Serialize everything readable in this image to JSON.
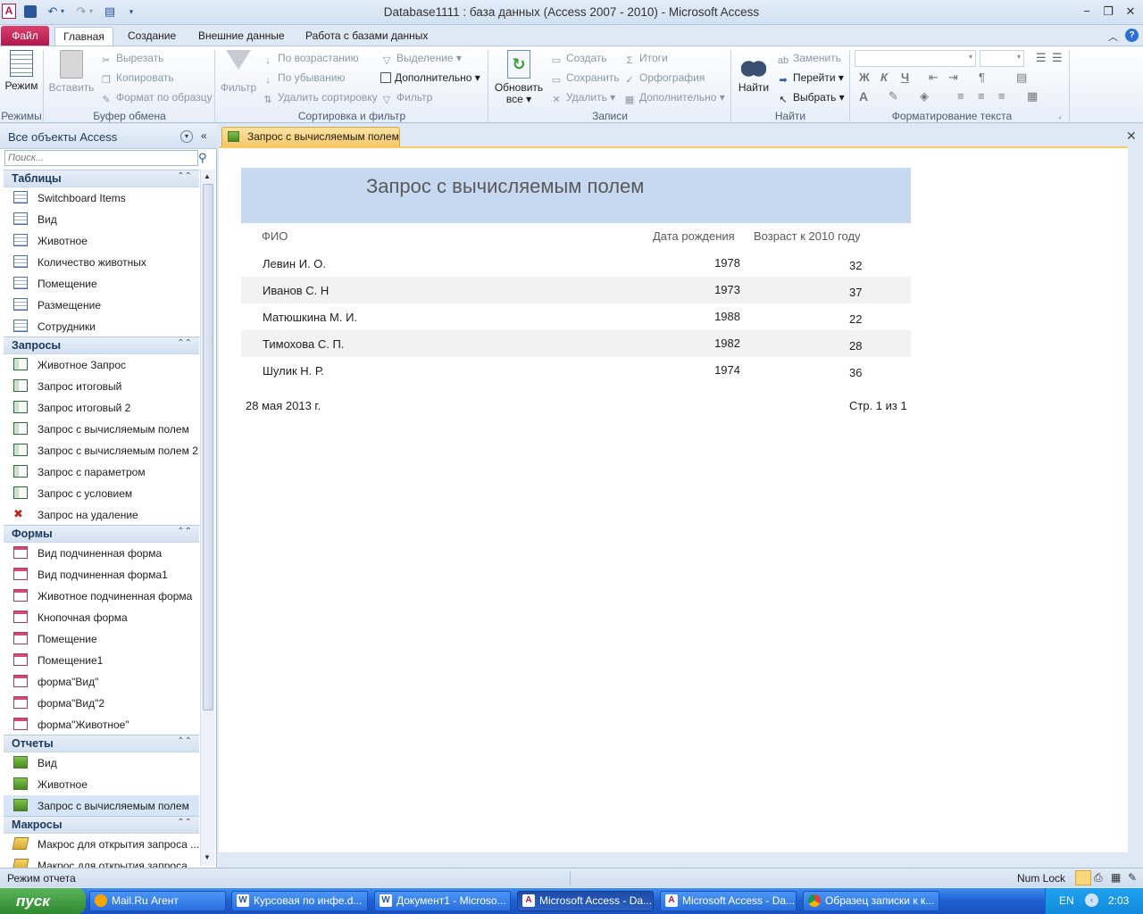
{
  "window": {
    "title": "Database1111 : база данных (Access 2007 - 2010)  -  Microsoft Access"
  },
  "ribbon": {
    "tabs": [
      "Файл",
      "Главная",
      "Создание",
      "Внешние данные",
      "Работа с базами данных"
    ],
    "groups": {
      "views": {
        "label": "Режимы",
        "button": "Режим"
      },
      "clipboard": {
        "label": "Буфер обмена",
        "paste": "Вставить",
        "cut": "Вырезать",
        "copy": "Копировать",
        "format_painter": "Формат по образцу"
      },
      "sort_filter": {
        "label": "Сортировка и фильтр",
        "filter": "Фильтр",
        "ascending": "По возрастанию",
        "descending": "По убыванию",
        "remove_sort": "Удалить сортировку",
        "selection": "Выделение",
        "advanced": "Дополнительно",
        "toggle_filter": "Фильтр"
      },
      "records": {
        "label": "Записи",
        "refresh_line1": "Обновить",
        "refresh_line2": "все",
        "new": "Создать",
        "save": "Сохранить",
        "delete": "Удалить",
        "totals": "Итоги",
        "spelling": "Орфография",
        "more": "Дополнительно"
      },
      "find": {
        "label": "Найти",
        "find": "Найти",
        "replace": "Заменить",
        "goto": "Перейти",
        "select": "Выбрать"
      },
      "text_format": {
        "label": "Форматирование текста",
        "bold": "Ж",
        "italic": "К",
        "underline": "Ч"
      }
    }
  },
  "nav": {
    "header": "Все объекты Access",
    "search_placeholder": "Поиск...",
    "sections": [
      {
        "title": "Таблицы",
        "type": "table",
        "items": [
          "Switchboard Items",
          "Вид",
          "Животное",
          "Количество животных",
          "Помещение",
          "Размещение",
          "Сотрудники"
        ]
      },
      {
        "title": "Запросы",
        "type": "query",
        "items": [
          "Животное Запрос",
          "Запрос итоговый",
          "Запрос итоговый 2",
          "Запрос с вычисляемым полем",
          "Запрос с вычисляемым полем 2",
          "Запрос с параметром",
          "Запрос с условием",
          "Запрос на удаление"
        ]
      },
      {
        "title": "Формы",
        "type": "form",
        "items": [
          "Вид подчиненная форма",
          "Вид подчиненная форма1",
          "Животное подчиненная форма",
          "Кнопочная форма",
          "Помещение",
          "Помещение1",
          "форма\"Вид\"",
          "форма\"Вид\"2",
          "форма\"Животное\""
        ]
      },
      {
        "title": "Отчеты",
        "type": "report",
        "items": [
          "Вид",
          "Животное",
          "Запрос с вычисляемым полем"
        ]
      },
      {
        "title": "Макросы",
        "type": "macro",
        "items": [
          "Макрос для открытия запроса ...",
          "Макрос для открытия запроса ..."
        ]
      }
    ]
  },
  "document": {
    "tab_title": "Запрос с вычисляемым полем",
    "report": {
      "title": "Запрос с вычисляемым полем",
      "columns": [
        "ФИО",
        "Дата рождения",
        "Возраст к 2010 году"
      ],
      "rows": [
        {
          "fio": "Левин И. О.",
          "year": "1978",
          "age": "32"
        },
        {
          "fio": "Иванов С. Н",
          "year": "1973",
          "age": "37"
        },
        {
          "fio": "Матюшкина М. И.",
          "year": "1988",
          "age": "22"
        },
        {
          "fio": "Тимохова С. П.",
          "year": "1982",
          "age": "28"
        },
        {
          "fio": "Шулик Н. Р.",
          "year": "1974",
          "age": "36"
        }
      ],
      "date": "28 мая 2013 г.",
      "page": "Стр. 1 из 1"
    }
  },
  "status": {
    "mode": "Режим отчета",
    "numlock": "Num Lock"
  },
  "taskbar": {
    "start": "пуск",
    "tasks": [
      "Mail.Ru Агент",
      "Курсовая по инфе.d...",
      "Документ1 - Microso...",
      "Microsoft Access - Da...",
      "Microsoft Access - Da...",
      "Образец записки к к..."
    ],
    "lang": "EN",
    "time": "2:03"
  },
  "colors": {
    "file_tab": "#c4274f",
    "report_header": "#c6d9f1",
    "doc_tab": "#f7c868",
    "taskbar": "#245edb"
  }
}
